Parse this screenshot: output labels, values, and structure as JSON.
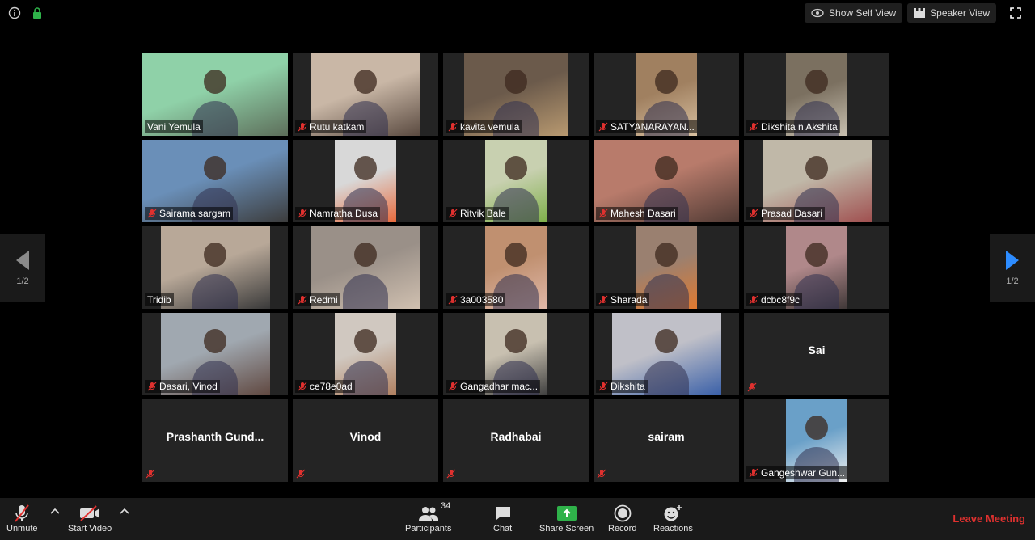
{
  "top_bar": {
    "show_self_view": "Show Self View",
    "speaker_view": "Speaker View"
  },
  "pager": {
    "left": "1/2",
    "right": "1/2"
  },
  "tiles": [
    {
      "name": "Vani Yemula",
      "muted": false,
      "video": true,
      "active": true
    },
    {
      "name": "Rutu katkam",
      "muted": true,
      "video": true
    },
    {
      "name": "kavita vemula",
      "muted": true,
      "video": true
    },
    {
      "name": "SATYANARAYAN...",
      "muted": true,
      "video": true
    },
    {
      "name": "Dikshita n Akshita",
      "muted": true,
      "video": true
    },
    {
      "name": "Sairama sargam",
      "muted": true,
      "video": true
    },
    {
      "name": "Namratha Dusa",
      "muted": true,
      "video": true
    },
    {
      "name": "Ritvik Bale",
      "muted": true,
      "video": true
    },
    {
      "name": "Mahesh Dasari",
      "muted": true,
      "video": true
    },
    {
      "name": "Prasad Dasari",
      "muted": true,
      "video": true
    },
    {
      "name": "Tridib",
      "muted": false,
      "video": true
    },
    {
      "name": "Redmi",
      "muted": true,
      "video": true
    },
    {
      "name": "3a003580",
      "muted": true,
      "video": true
    },
    {
      "name": "Sharada",
      "muted": true,
      "video": true
    },
    {
      "name": "dcbc8f9c",
      "muted": true,
      "video": true
    },
    {
      "name": "Dasari, Vinod",
      "muted": true,
      "video": true
    },
    {
      "name": "ce78e0ad",
      "muted": true,
      "video": true
    },
    {
      "name": "Gangadhar mac...",
      "muted": true,
      "video": true
    },
    {
      "name": "Dikshita",
      "muted": true,
      "video": true
    },
    {
      "name": "Sai",
      "muted": true,
      "video": false
    },
    {
      "name": "Prashanth  Gund...",
      "muted": true,
      "video": false
    },
    {
      "name": "Vinod",
      "muted": true,
      "video": false
    },
    {
      "name": "Radhabai",
      "muted": true,
      "video": false
    },
    {
      "name": "sairam",
      "muted": true,
      "video": false
    },
    {
      "name": "Gangeshwar Gun...",
      "muted": true,
      "video": true
    }
  ],
  "toolbar": {
    "unmute": "Unmute",
    "start_video": "Start Video",
    "participants": "Participants",
    "participant_count": "34",
    "chat": "Chat",
    "share_screen": "Share Screen",
    "record": "Record",
    "reactions": "Reactions",
    "leave": "Leave Meeting"
  },
  "colors": {
    "active_border": "#d8e66a",
    "leave": "#e0312f",
    "share_green": "#2fb24a",
    "nav_arrow": "#2d8cff",
    "muted_red": "#e0312f"
  }
}
